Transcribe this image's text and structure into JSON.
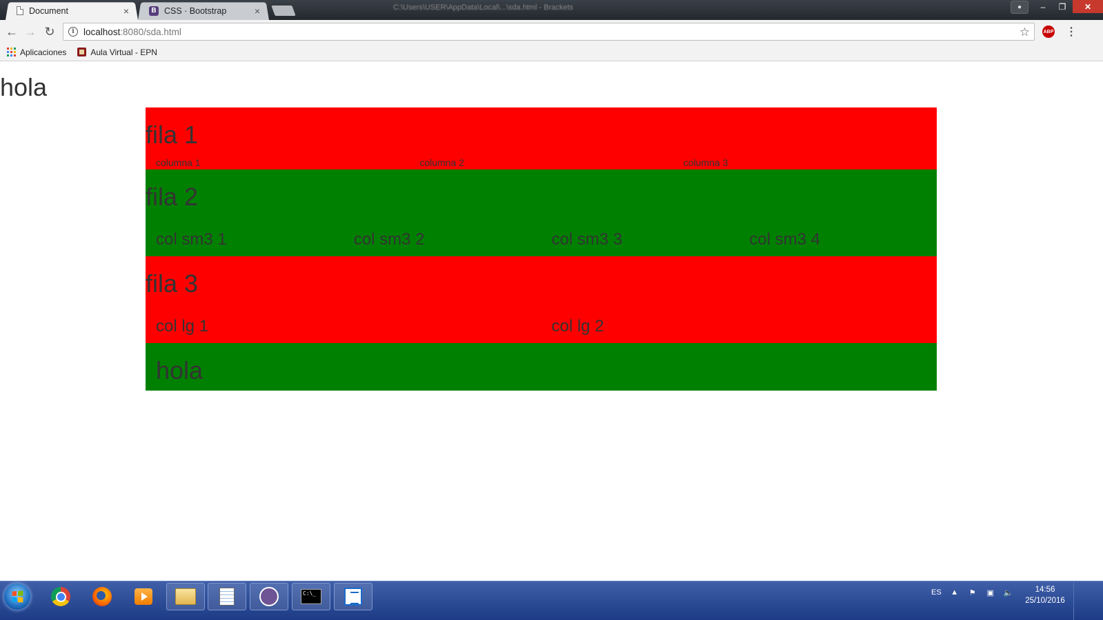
{
  "browser": {
    "tabs": [
      {
        "label": "Document",
        "close": "×"
      },
      {
        "label": "CSS · Bootstrap",
        "close": "×",
        "icon_letter": "B"
      }
    ],
    "window_title": "C:\\Users\\USER\\AppData\\Local\\...\\sda.html - Brackets",
    "window_buttons": {
      "minimize": "–",
      "restore": "❐",
      "close": "✕"
    },
    "nav": {
      "back": "←",
      "forward": "→",
      "reload": "↻"
    },
    "url_host": "localhost",
    "url_rest": ":8080/sda.html",
    "bookmarks": [
      {
        "label": "Aplicaciones",
        "icon": "apps-icon"
      },
      {
        "label": "Aula Virtual - EPN",
        "icon": "epn-icon"
      }
    ],
    "abp_label": "ABP"
  },
  "page": {
    "heading": "hola",
    "rows": [
      {
        "title": "fila 1",
        "color": "#ff0000",
        "cols": [
          "columna 1",
          "columna 2",
          "columna 3"
        ]
      },
      {
        "title": "fila 2",
        "color": "#008000",
        "cols": [
          "col sm3 1",
          "col sm3 2",
          "col sm3 3",
          "col sm3 4"
        ]
      },
      {
        "title": "fila 3",
        "color": "#ff0000",
        "cols": [
          "col lg 1",
          "col lg 2"
        ]
      },
      {
        "title": "",
        "color": "#008000",
        "cols": [
          "hola"
        ]
      }
    ]
  },
  "taskbar": {
    "apps": [
      "chrome-icon",
      "firefox-icon",
      "media-player-icon",
      "file-explorer-icon",
      "notepad-icon",
      "github-icon",
      "cmd-icon",
      "brackets-icon"
    ],
    "language": "ES",
    "time": "14:56",
    "date": "25/10/2016"
  }
}
